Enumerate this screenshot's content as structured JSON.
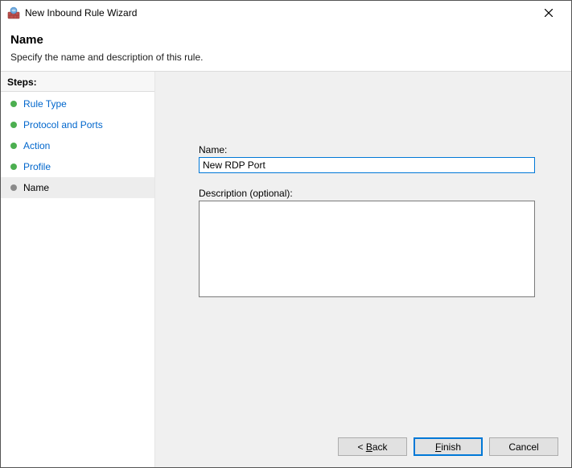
{
  "window": {
    "title": "New Inbound Rule Wizard"
  },
  "header": {
    "title": "Name",
    "subtitle": "Specify the name and description of this rule."
  },
  "sidebar": {
    "heading": "Steps:",
    "items": [
      {
        "label": "Rule Type"
      },
      {
        "label": "Protocol and Ports"
      },
      {
        "label": "Action"
      },
      {
        "label": "Profile"
      },
      {
        "label": "Name"
      }
    ],
    "current_index": 4
  },
  "form": {
    "name_label": "Name:",
    "name_value": "New RDP Port",
    "description_label": "Description (optional):",
    "description_value": ""
  },
  "buttons": {
    "back": "< Back",
    "finish": "Finish",
    "cancel": "Cancel"
  }
}
